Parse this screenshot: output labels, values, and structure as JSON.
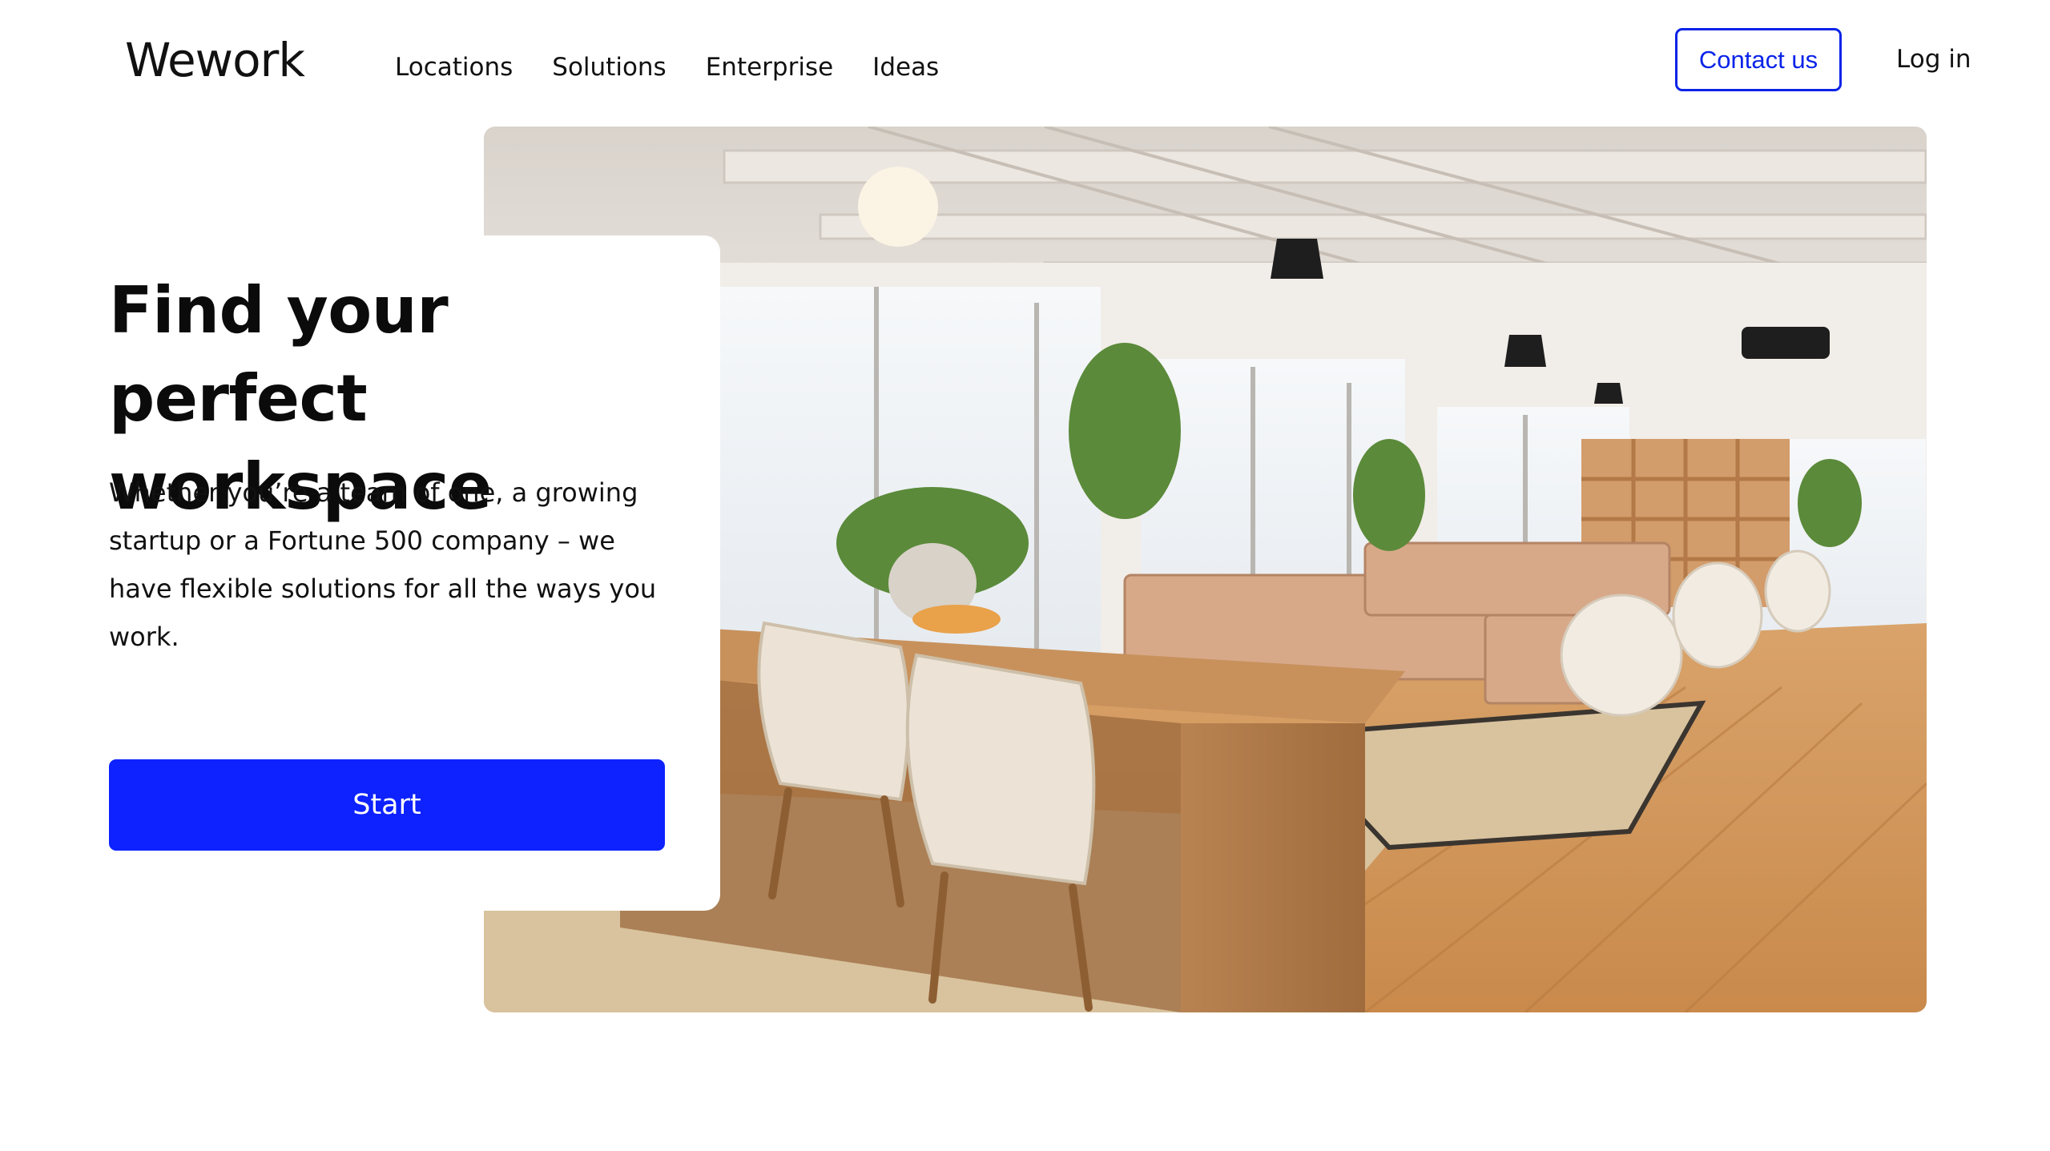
{
  "header": {
    "logo": "Wework",
    "nav": [
      "Locations",
      "Solutions",
      "Enterprise",
      "Ideas"
    ],
    "contact_label": "Contact us",
    "login_label": "Log in"
  },
  "hero": {
    "title": "Find your perfect workspace",
    "body": "Whether you’re a team of one, a growing startup or a Fortune 500 company – we have flexible solutions for all the ways you work.",
    "cta_label": "Start",
    "image_alt": "Bright open-plan office with wooden tables, beige chairs, lounge sofas and large windows"
  },
  "colors": {
    "accent": "#0d22ff",
    "text": "#111111",
    "background": "#ffffff"
  }
}
